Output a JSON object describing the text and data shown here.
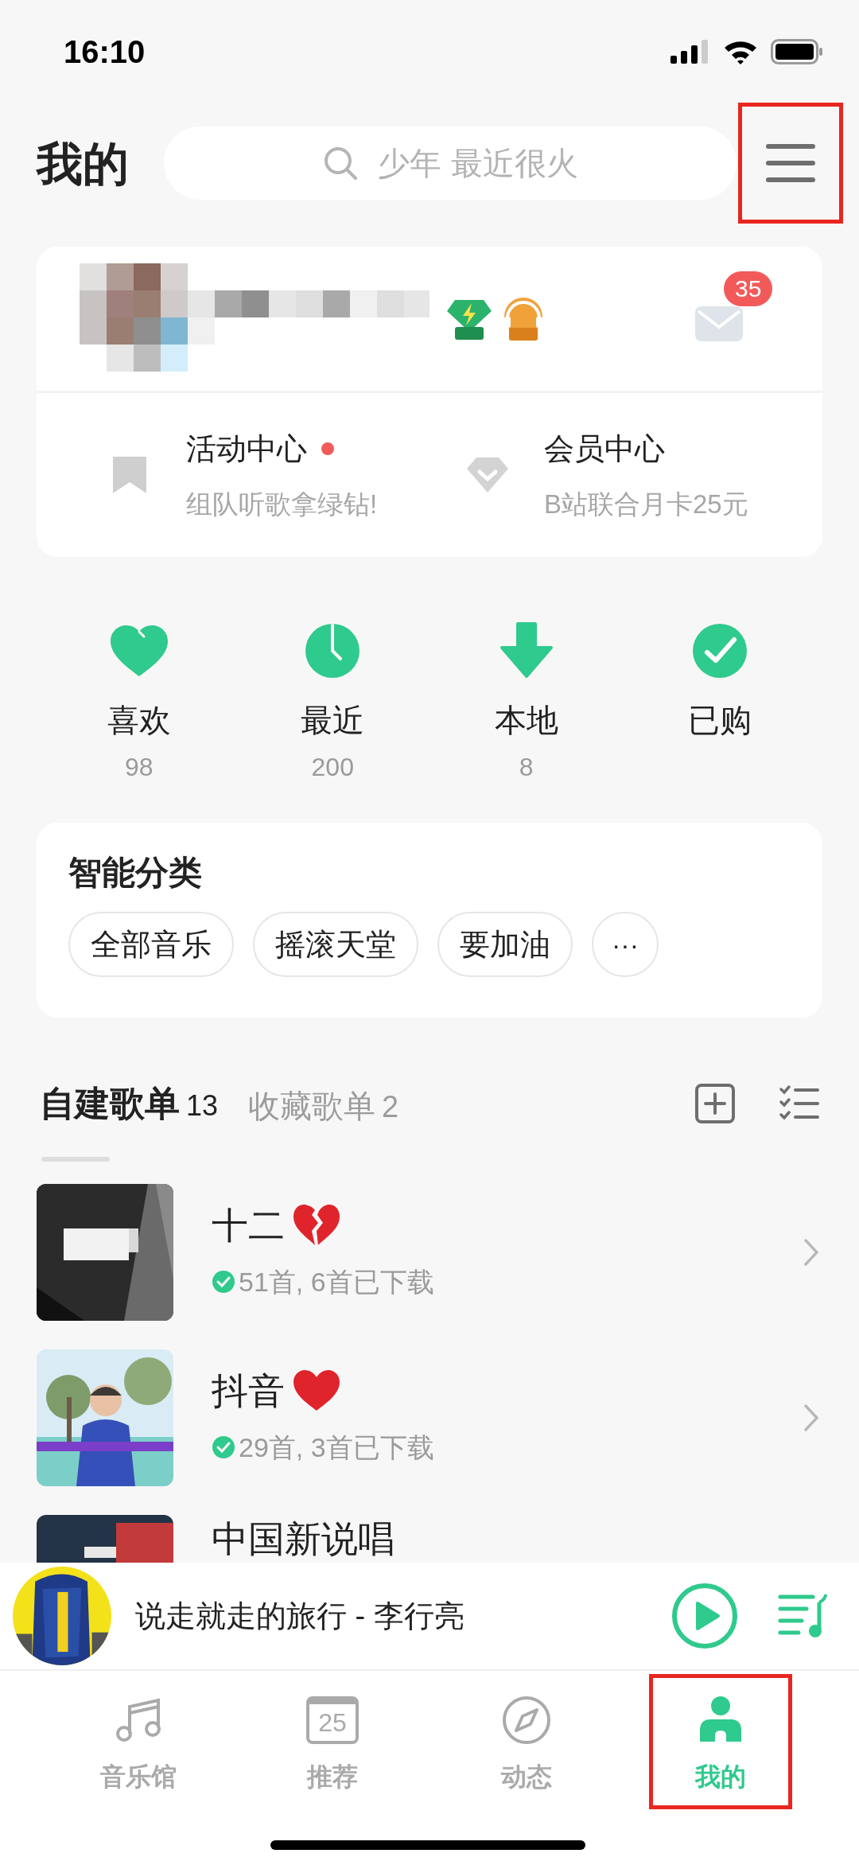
{
  "status_bar": {
    "time": "16:10"
  },
  "header": {
    "title": "我的",
    "search": {
      "placeholder": "少年 最近很火"
    },
    "menu": {
      "highlighted": true
    }
  },
  "profile": {
    "message_count": "35"
  },
  "promos": [
    {
      "kind": "bookmark",
      "title": "活动中心",
      "dot": true,
      "subtitle": "组队听歌拿绿钻!"
    },
    {
      "kind": "diamond",
      "title": "会员中心",
      "dot": false,
      "subtitle": "B站联合月卡25元"
    }
  ],
  "shortcuts": [
    {
      "kind": "heart",
      "label": "喜欢",
      "count": "98"
    },
    {
      "kind": "clock",
      "label": "最近",
      "count": "200"
    },
    {
      "kind": "download",
      "label": "本地",
      "count": "8"
    },
    {
      "kind": "check",
      "label": "已购"
    }
  ],
  "smart_categories": {
    "title": "智能分类",
    "tags": [
      "全部音乐",
      "摇滚天堂",
      "要加油"
    ],
    "more": "···"
  },
  "playlist_tabs": [
    {
      "label": "自建歌单",
      "count": "13",
      "selected": true
    },
    {
      "label": "收藏歌单",
      "count": "2",
      "selected": false
    }
  ],
  "playlists": [
    {
      "title": "十二",
      "kind": "broken_heart",
      "downloaded": true,
      "info": "51首, 6首已下载"
    },
    {
      "title": "抖音",
      "kind": "heart",
      "downloaded": true,
      "info": "29首, 3首已下载"
    },
    {
      "title": "中国新说唱"
    }
  ],
  "player": {
    "track": "说走就走的旅行 - 李行亮"
  },
  "tabs": [
    {
      "kind": "note",
      "label": "音乐馆",
      "selected": false,
      "highlighted": false
    },
    {
      "kind": "calendar",
      "icon_text": "25",
      "label": "推荐",
      "selected": false,
      "highlighted": false
    },
    {
      "kind": "compass",
      "label": "动态",
      "selected": false,
      "highlighted": false
    },
    {
      "kind": "person",
      "label": "我的",
      "selected": true,
      "highlighted": true
    }
  ]
}
